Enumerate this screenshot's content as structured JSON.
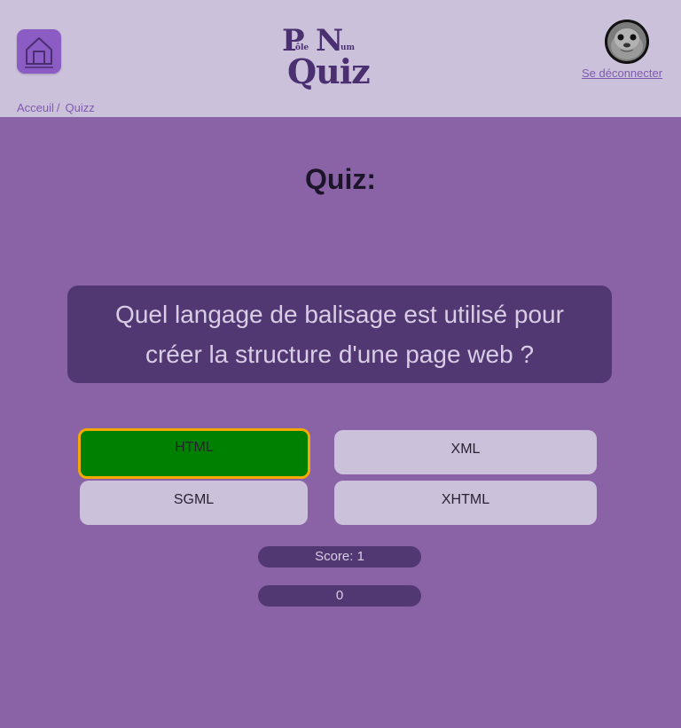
{
  "header": {
    "logo": {
      "p": "P",
      "ole": "ôle",
      "n": "N",
      "um": "um",
      "quiz": "Quiz"
    },
    "logout_label": "Se déconnecter"
  },
  "breadcrumb": {
    "home": "Acceuil",
    "separator": "/",
    "current": "Quizz"
  },
  "page": {
    "title": "Quiz:"
  },
  "question": {
    "text": "Quel langage de balisage est utilisé pour créer la structure d'une page web ?"
  },
  "answers": [
    {
      "label": "HTML",
      "state": "correct"
    },
    {
      "label": "XML",
      "state": "default"
    },
    {
      "label": "SGML",
      "state": "default"
    },
    {
      "label": "XHTML",
      "state": "default"
    }
  ],
  "score": {
    "label": "Score: 1"
  },
  "counter": {
    "value": "0"
  },
  "colors": {
    "header_bg": "#ccc1db",
    "page_bg": "#8a63a7",
    "question_bg": "#523873",
    "correct": "#008000",
    "correct_border": "#f5a800"
  },
  "icons": {
    "home": "home-icon",
    "avatar": "seal-avatar"
  }
}
